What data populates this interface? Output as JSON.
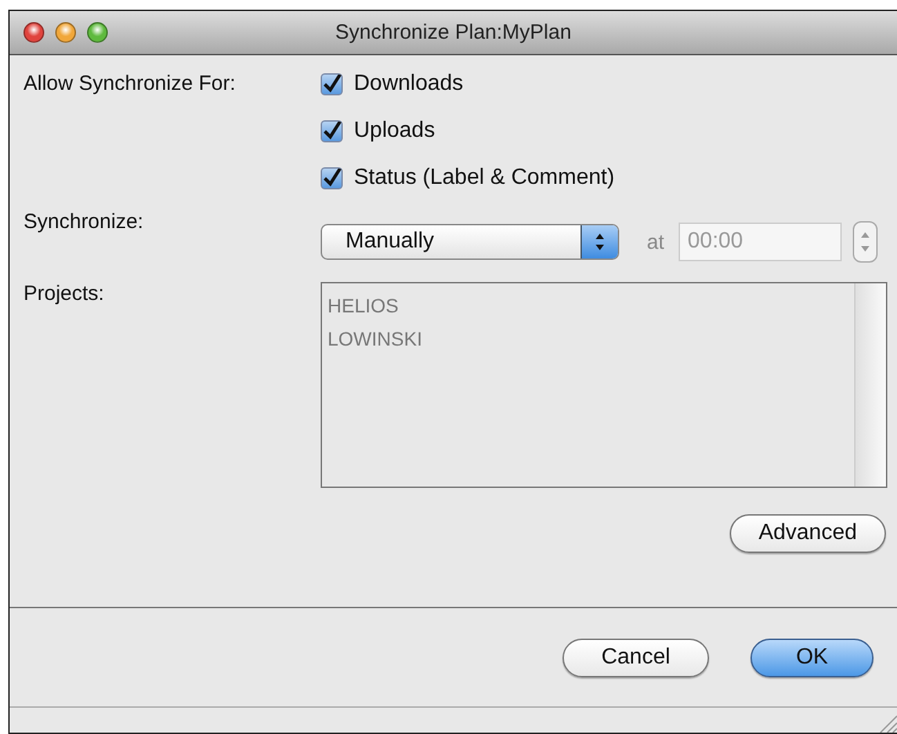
{
  "window": {
    "title": "Synchronize Plan:MyPlan"
  },
  "allow_label": "Allow Synchronize For:",
  "options": [
    {
      "label": "Downloads",
      "checked": true
    },
    {
      "label": "Uploads",
      "checked": true
    },
    {
      "label": "Status (Label & Comment)",
      "checked": true
    }
  ],
  "synchronize": {
    "label": "Synchronize:",
    "value": "Manually",
    "at_label": "at",
    "time": "00:00",
    "time_disabled": true
  },
  "projects": {
    "label": "Projects:",
    "disabled": true,
    "items": [
      "HELIOS",
      "LOWINSKI"
    ]
  },
  "advanced_button": "Advanced",
  "buttons": [
    {
      "label": "Cancel",
      "default": false
    },
    {
      "label": "OK",
      "default": true
    }
  ]
}
